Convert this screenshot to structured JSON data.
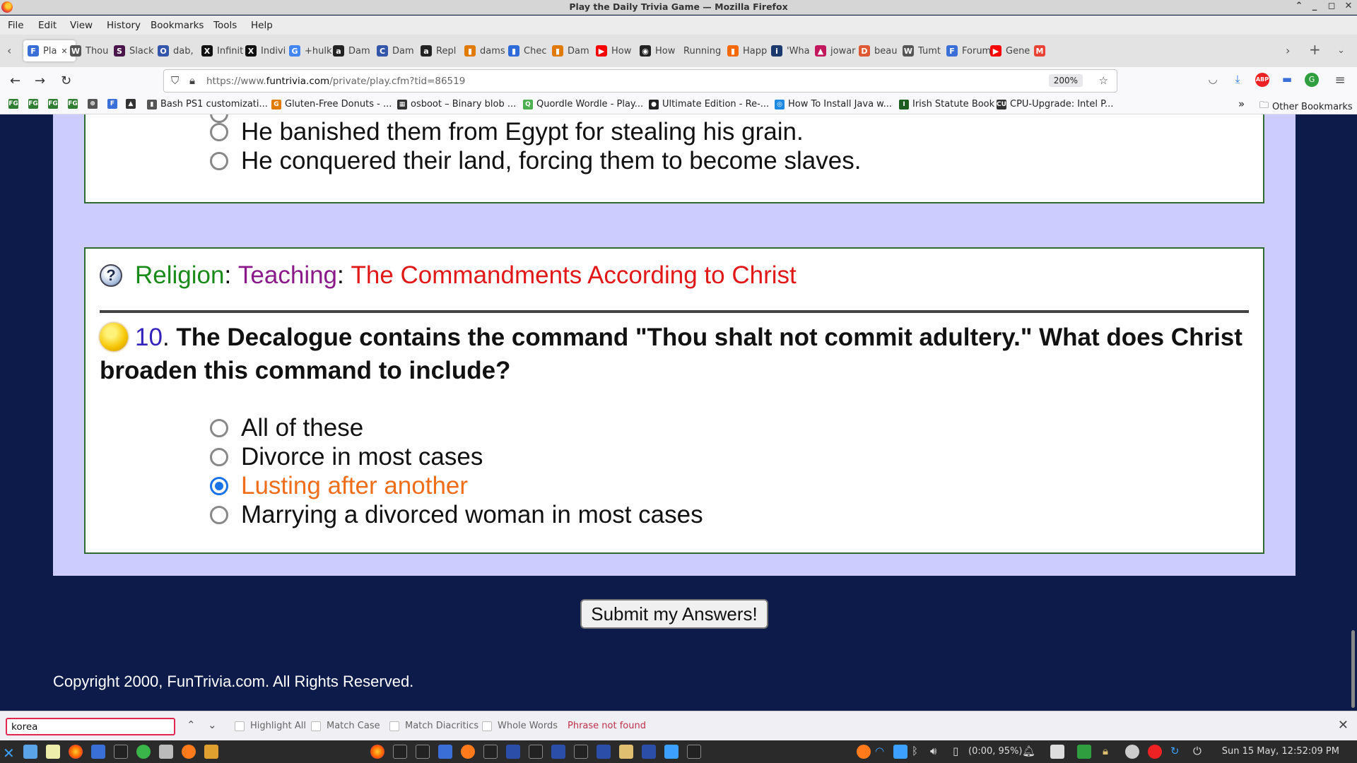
{
  "window": {
    "title": "Play the Daily Trivia Game — Mozilla Firefox"
  },
  "menu": [
    "File",
    "Edit",
    "View",
    "History",
    "Bookmarks",
    "Tools",
    "Help"
  ],
  "tabs": [
    {
      "label": "Pla",
      "icon": "funtrivia-icon",
      "color": "#3b6fd8",
      "glyph": "F"
    },
    {
      "label": "Thou",
      "icon": "wikipedia-icon",
      "color": "#555555",
      "glyph": "W"
    },
    {
      "label": "Slack",
      "icon": "slack-icon",
      "color": "#4a154b",
      "glyph": "S"
    },
    {
      "label": "dab,",
      "icon": "bookmark-icon",
      "color": "#3355aa",
      "glyph": "O"
    },
    {
      "label": "Infinit",
      "icon": "x-icon",
      "color": "#111111",
      "glyph": "X"
    },
    {
      "label": "Indivi",
      "icon": "x-icon",
      "color": "#111111",
      "glyph": "X"
    },
    {
      "label": "+hulk",
      "icon": "google-icon",
      "color": "#4285f4",
      "glyph": "G"
    },
    {
      "label": "Dam",
      "icon": "amazon-icon",
      "color": "#222222",
      "glyph": "a"
    },
    {
      "label": "Dam",
      "icon": "refresh-icon",
      "color": "#3355aa",
      "glyph": "C"
    },
    {
      "label": "Repl",
      "icon": "amazon-icon",
      "color": "#222222",
      "glyph": "a"
    },
    {
      "label": "dams",
      "icon": "bag-icon",
      "color": "#e07b00",
      "glyph": "▮"
    },
    {
      "label": "Chec",
      "icon": "bag-icon",
      "color": "#2d6bd8",
      "glyph": "▮"
    },
    {
      "label": "Dam",
      "icon": "bag-icon",
      "color": "#e07b00",
      "glyph": "▮"
    },
    {
      "label": "How",
      "icon": "youtube-icon",
      "color": "#ff0000",
      "glyph": "▶"
    },
    {
      "label": "How",
      "icon": "github-icon",
      "color": "#222222",
      "glyph": "◉"
    },
    {
      "label": "Running",
      "icon": "",
      "color": "#e3e3e3",
      "glyph": ""
    },
    {
      "label": "Happ",
      "icon": "chart-icon",
      "color": "#ff6a00",
      "glyph": "▮"
    },
    {
      "label": "'Wha",
      "icon": "info-icon",
      "color": "#1b3a6b",
      "glyph": "i"
    },
    {
      "label": "jowar",
      "icon": "flag-icon",
      "color": "#c2185b",
      "glyph": "▲"
    },
    {
      "label": "beau",
      "icon": "duckduckgo-icon",
      "color": "#de5833",
      "glyph": "D"
    },
    {
      "label": "Tumt",
      "icon": "wikipedia-icon",
      "color": "#555555",
      "glyph": "W"
    },
    {
      "label": "Forum",
      "icon": "funtrivia-icon",
      "color": "#3b6fd8",
      "glyph": "F"
    },
    {
      "label": "Gene",
      "icon": "youtube-icon",
      "color": "#ff0000",
      "glyph": "▶"
    },
    {
      "label": "",
      "icon": "gmail-icon",
      "color": "#ea4335",
      "glyph": "M"
    }
  ],
  "url": {
    "prefix": "https://www.",
    "domain": "funtrivia.com",
    "path": "/private/play.cfm?tid=86519",
    "zoom": "200%"
  },
  "bookmarks": [
    {
      "label": "",
      "color": "#2e7d32",
      "glyph": "FG"
    },
    {
      "label": "",
      "color": "#2e7d32",
      "glyph": "FG"
    },
    {
      "label": "",
      "color": "#2e7d32",
      "glyph": "FG"
    },
    {
      "label": "",
      "color": "#2e7d32",
      "glyph": "FG"
    },
    {
      "label": "",
      "color": "#555555",
      "glyph": "⊕"
    },
    {
      "label": "",
      "color": "#3b6fd8",
      "glyph": "F"
    },
    {
      "label": "",
      "color": "#333333",
      "glyph": "▲"
    },
    {
      "label": "Bash PS1 customizati...",
      "color": "#555555",
      "glyph": "▮"
    },
    {
      "label": "Gluten-Free Donuts - ...",
      "color": "#e07b00",
      "glyph": "G"
    },
    {
      "label": "osboot – Binary blob ...",
      "color": "#333333",
      "glyph": "▦"
    },
    {
      "label": "Quordle Wordle - Play...",
      "color": "#4caf50",
      "glyph": "Q"
    },
    {
      "label": "Ultimate Edition - Re-...",
      "color": "#222222",
      "glyph": "●"
    },
    {
      "label": "How To Install Java w...",
      "color": "#1e88e5",
      "glyph": "◎"
    },
    {
      "label": "Irish Statute Book",
      "color": "#1b5e20",
      "glyph": "I"
    },
    {
      "label": "CPU-Upgrade: Intel P...",
      "color": "#333333",
      "glyph": "CU"
    }
  ],
  "bookmarks_other": "Other Bookmarks",
  "prev_question": {
    "options": [
      "He banished them from Egypt for stealing his grain.",
      "He conquered their land, forcing them to become slaves."
    ]
  },
  "question": {
    "category": "Religion",
    "subcategory": "Teaching",
    "quiz_title": "The Commandments According to Christ",
    "number": "10",
    "text": "The Decalogue contains the command \"Thou shalt not commit adultery.\" What does Christ broaden this command to include?",
    "options": [
      {
        "label": "All of these",
        "selected": false
      },
      {
        "label": "Divorce in most cases",
        "selected": false
      },
      {
        "label": "Lusting after another",
        "selected": true
      },
      {
        "label": "Marrying a divorced woman in most cases",
        "selected": false
      }
    ],
    "colors": {
      "category": "#1a8a1a",
      "subcategory": "#8a1a8a",
      "title": "#e21818",
      "number": "#3322bb",
      "selected": "#f06d1a"
    }
  },
  "submit_label": "Submit my Answers!",
  "copyright": "Copyright 2000, FunTrivia.com. All Rights Reserved.",
  "findbar": {
    "query": "korea",
    "highlight_all": "Highlight All",
    "match_case": "Match Case",
    "match_diacritics": "Match Diacritics",
    "whole_words": "Whole Words",
    "status": "Phrase not found"
  },
  "taskbar": {
    "battery": "(0:00, 95%)",
    "clock": "Sun 15 May, 12:52:09 PM"
  }
}
